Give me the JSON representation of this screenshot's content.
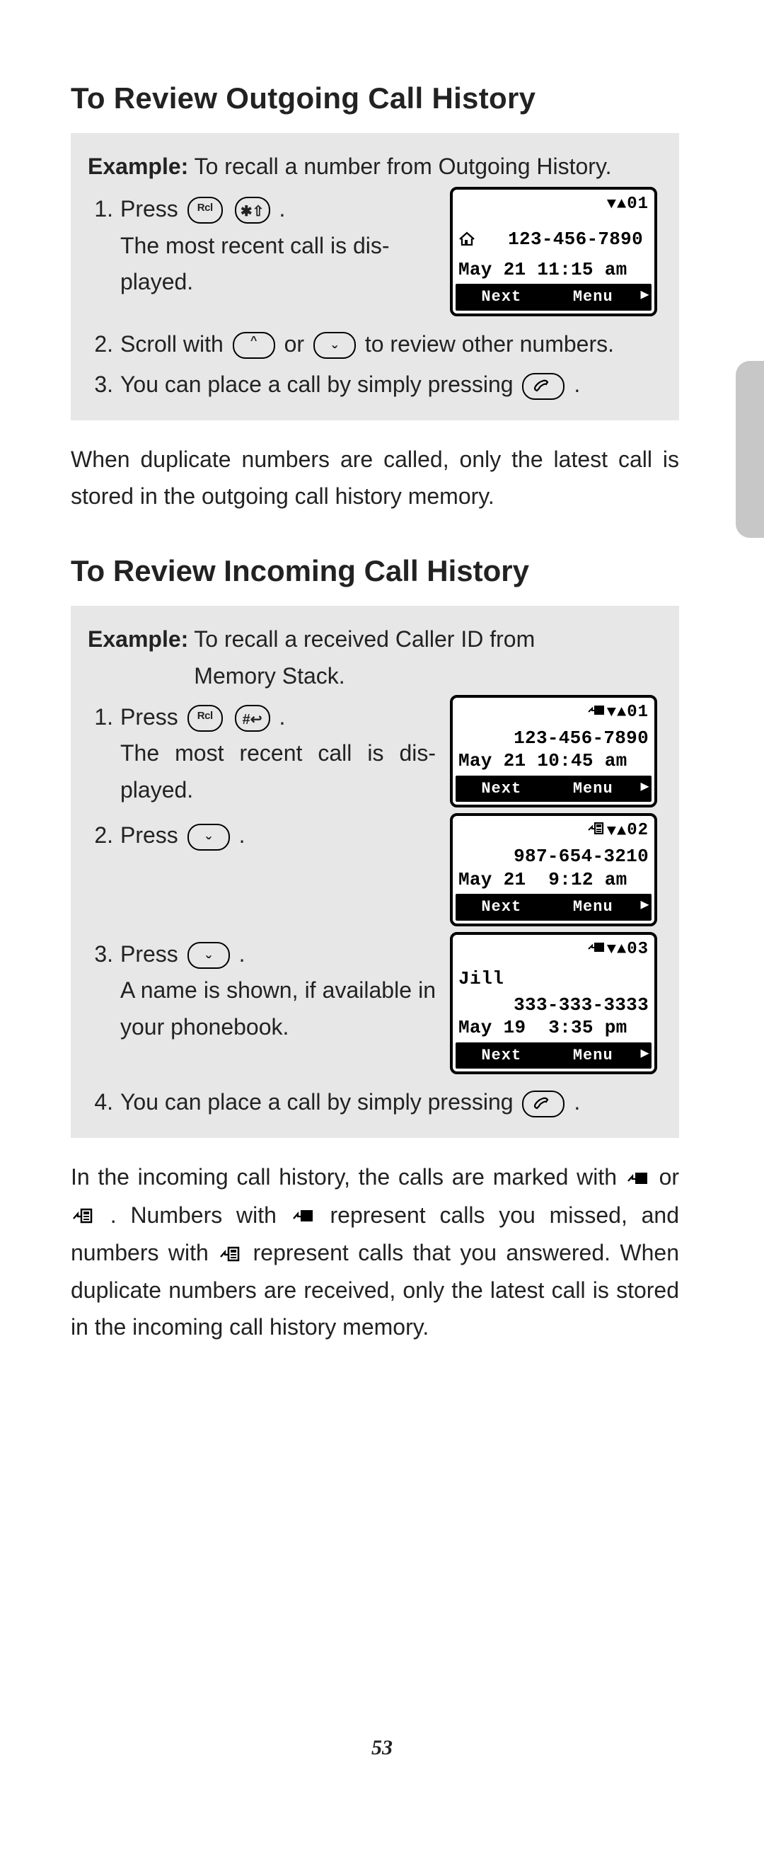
{
  "section1": {
    "heading": "To Review Outgoing Call History",
    "example_label": "Example:",
    "example_text": "To recall a number from Outgoing History.",
    "step1_a": "Press",
    "step1_b": "The most recent call is dis­played.",
    "step2_a": "Scroll with",
    "step2_b": "or",
    "step2_c": "to review other numbers.",
    "step3_a": "You can place a call by simply pressing",
    "after": "When duplicate numbers are called, only the latest call is stored in the outgoing call history memory.",
    "screen": {
      "index": "01",
      "number": "123-456-7890",
      "datetime": "May 21 11:15 am",
      "soft_left": "Next",
      "soft_right": "Menu"
    }
  },
  "section2": {
    "heading": "To Review Incoming Call History",
    "example_label": "Example:",
    "example_text_a": "To recall a received Caller ID from",
    "example_text_b": "Memory Stack.",
    "step1_a": "Press",
    "step1_b": "The most recent call is dis­played.",
    "step2_a": "Press",
    "step3_a": "Press",
    "step3_b": "A name is shown, if available in your phonebook.",
    "step4_a": "You can place a call by simply pressing",
    "screens": [
      {
        "index": "01",
        "name": "",
        "number": "123-456-7890",
        "datetime": "May 21 10:45 am",
        "soft_left": "Next",
        "soft_right": "Menu",
        "icon": "missed"
      },
      {
        "index": "02",
        "name": "",
        "number": "987-654-3210",
        "datetime": "May 21  9:12 am",
        "soft_left": "Next",
        "soft_right": "Menu",
        "icon": "answered"
      },
      {
        "index": "03",
        "name": "Jill",
        "number": "333-333-3333",
        "datetime": "May 19  3:35 pm",
        "soft_left": "Next",
        "soft_right": "Menu",
        "icon": "missed"
      }
    ],
    "after_a": "In the incoming call history, the calls are marked with",
    "after_b": "or",
    "after_c": ". Numbers with",
    "after_d": "represent calls you missed, and numbers with",
    "after_e": "represent calls that you answered. When duplicate numbers are received, only the latest call is stored in the incoming call history memory."
  },
  "keys": {
    "rcl": "Rcl",
    "star": "✱⇧",
    "hash": "#↩"
  },
  "page_number": "53"
}
